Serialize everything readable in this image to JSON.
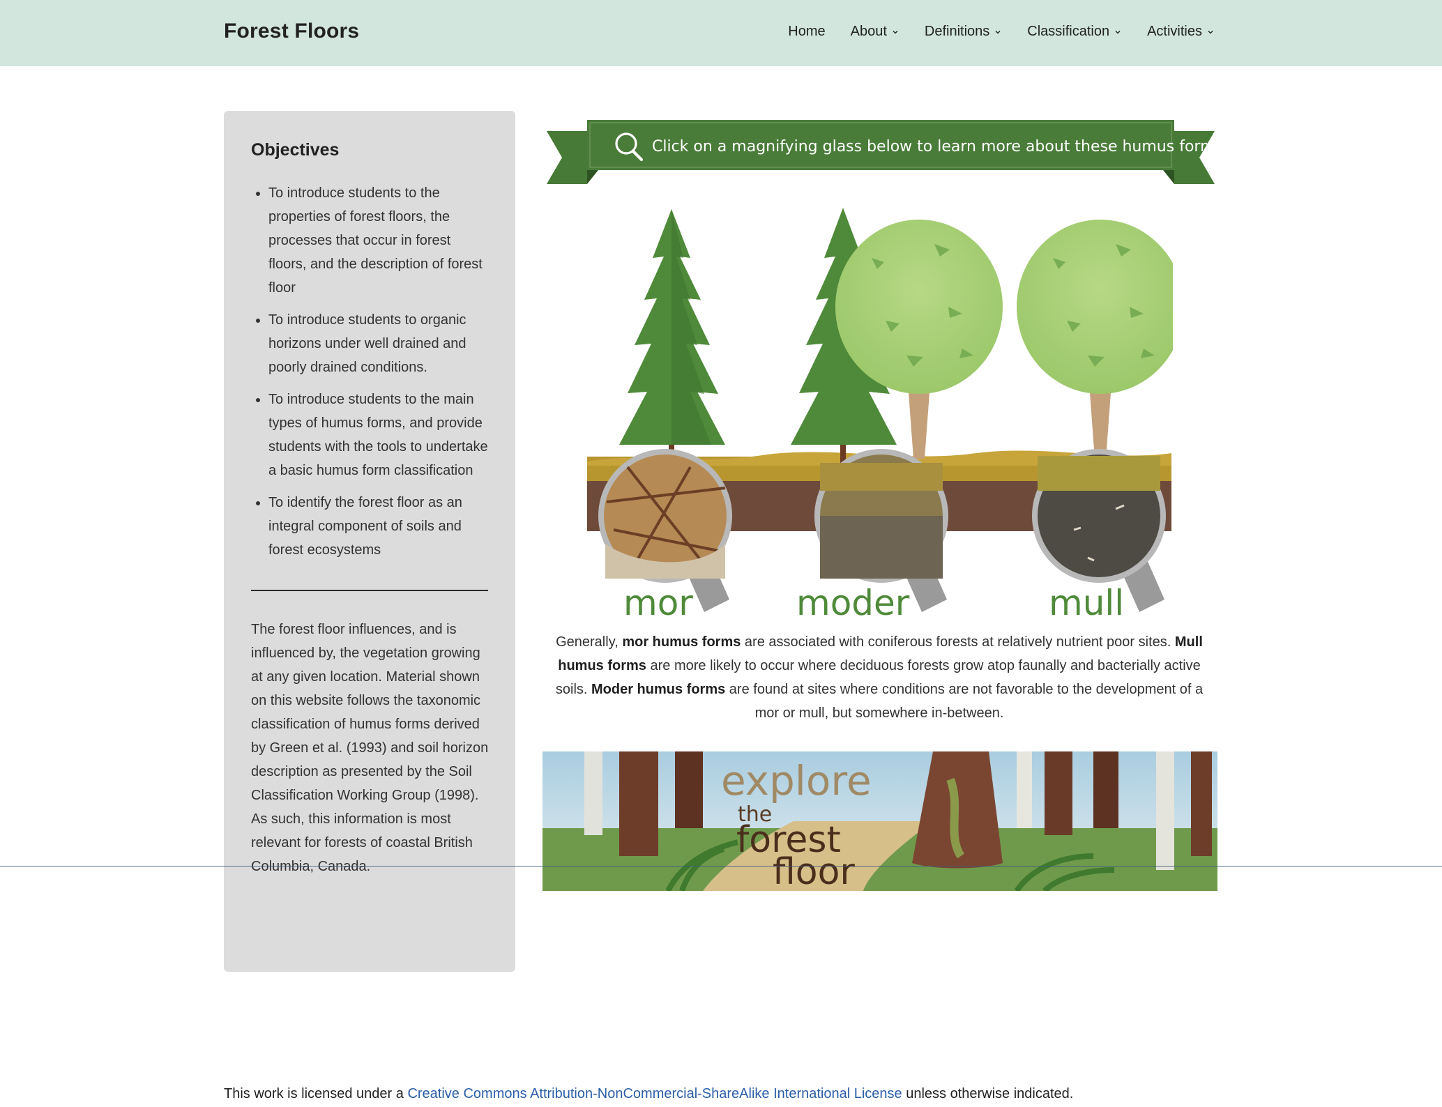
{
  "header": {
    "site_title": "Forest Floors",
    "nav": [
      {
        "label": "Home",
        "has_dropdown": false
      },
      {
        "label": "About",
        "has_dropdown": true
      },
      {
        "label": "Definitions",
        "has_dropdown": true
      },
      {
        "label": "Classification",
        "has_dropdown": true
      },
      {
        "label": "Activities",
        "has_dropdown": true
      }
    ]
  },
  "sidebar": {
    "title": "Objectives",
    "objectives": [
      "To introduce students to the properties of forest floors, the processes that occur in forest floors, and the description of forest floor",
      "To introduce students to organic horizons under well drained and poorly drained conditions.",
      "To introduce students to the main types of humus forms, and provide students with the tools to undertake a basic humus form classification",
      "To identify the forest floor as an integral component of soils and forest ecosystems"
    ],
    "description": "The forest floor influences, and is influenced by, the vegetation growing at any given location. Material shown on this website follows the taxonomic classification of humus forms derived by Green et al. (1993) and soil horizon description as presented by the Soil Classification Working Group (1998). As such, this information is most relevant for forests of coastal British Columbia, Canada."
  },
  "banner": {
    "text": "Click on a magnifying glass below to learn more about these humus forms",
    "icon": "magnifying-glass-icon"
  },
  "humus_forms": {
    "mor": "mor",
    "moder": "moder",
    "mull": "mull"
  },
  "intro": {
    "p1": "Generally, ",
    "b1": "mor humus forms",
    "p2": " are associated with coniferous forests at relatively nutrient poor sites. ",
    "b2": "Mull humus forms",
    "p3": " are more likely to occur where deciduous forests grow atop faunally and bacterially active soils. ",
    "b3": "Moder humus forms",
    "p4": " are found at sites where conditions are not favorable to the development of a mor or mull, but somewhere in-between."
  },
  "explore": {
    "line1": "explore",
    "line2": "the",
    "line3": "forest",
    "line4": "floor"
  },
  "footer": {
    "prefix": "This work is licensed under a ",
    "link": "Creative Commons Attribution-NonCommercial-ShareAlike International License",
    "suffix": " unless otherwise indicated."
  },
  "colors": {
    "header_bg": "#d2e6dd",
    "sidebar_bg": "#dcdcdc",
    "banner_green": "#4a7c39",
    "label_green": "#4f8a3a",
    "link_blue": "#2b5ea8"
  }
}
